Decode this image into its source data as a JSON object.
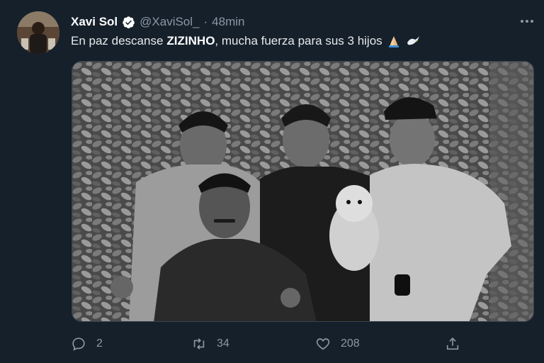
{
  "tweet": {
    "author": {
      "display_name": "Xavi Sol",
      "handle": "@XaviSol_",
      "verified_icon": "verified-badge-icon",
      "separator": "·",
      "time": "48min"
    },
    "text": {
      "prefix": "En paz descanse",
      "bold": "ZIZINHO",
      "suffix": ", mucha fuerza para sus 3 hijos",
      "emoji_1": "folded-hands-emoji",
      "emoji_2": "dove-emoji"
    },
    "media": {
      "kind": "photo",
      "color_scheme": "black-and-white"
    },
    "actions": {
      "reply_count": "2",
      "retweet_count": "34",
      "like_count": "208",
      "share_icon": "share-icon"
    },
    "colors": {
      "background": "#15202b",
      "text_primary": "#e7e9ea",
      "text_secondary": "#8b98a5",
      "verified": "#1d9bf0"
    }
  }
}
